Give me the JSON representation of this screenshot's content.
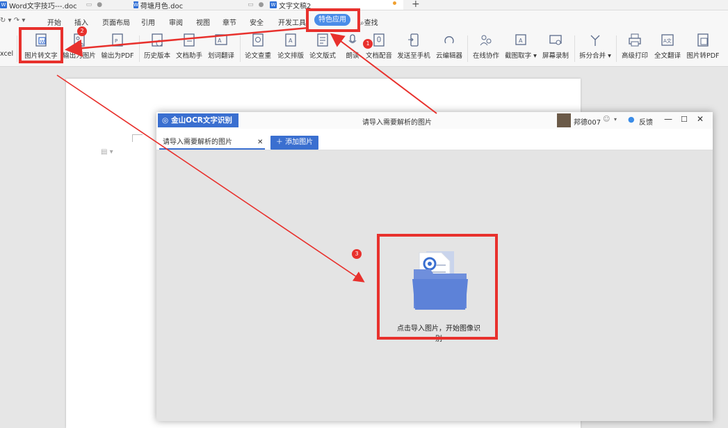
{
  "doc_tabs": [
    {
      "label": "Word文字技巧---.doc"
    },
    {
      "label": "荷塘月色.doc"
    },
    {
      "label": "文字文稿2"
    }
  ],
  "menu": {
    "items": [
      "开始",
      "插入",
      "页面布局",
      "引用",
      "审阅",
      "视图",
      "章节",
      "安全",
      "开发工具"
    ],
    "special": "特色应用",
    "search": "查找"
  },
  "ribbon": {
    "left_cut": "xcel",
    "tools": [
      {
        "label": "图片转文字",
        "icon": "image-to-text-icon"
      },
      {
        "label": "输出为图片",
        "icon": "export-image-icon"
      },
      {
        "label": "输出为PDF",
        "icon": "export-pdf-icon"
      },
      {
        "label": "历史版本",
        "icon": "history-icon"
      },
      {
        "label": "文档助手",
        "icon": "doc-assistant-icon"
      },
      {
        "label": "划词翻译",
        "icon": "translate-icon"
      },
      {
        "label": "论文查重",
        "icon": "paper-check-icon"
      },
      {
        "label": "论文排版",
        "icon": "paper-layout-icon"
      },
      {
        "label": "论文版式",
        "icon": "paper-format-icon"
      },
      {
        "label": "朗读",
        "icon": "read-aloud-icon"
      },
      {
        "label": "文档配音",
        "icon": "dubbing-icon"
      },
      {
        "label": "发送至手机",
        "icon": "send-phone-icon"
      },
      {
        "label": "云编辑器",
        "icon": "cloud-editor-icon"
      },
      {
        "label": "在线协作",
        "icon": "collaborate-icon"
      },
      {
        "label": "截图取字",
        "icon": "screenshot-text-icon"
      },
      {
        "label": "屏幕录制",
        "icon": "screen-record-icon"
      },
      {
        "label": "拆分合并",
        "icon": "split-merge-icon"
      },
      {
        "label": "高级打印",
        "icon": "print-icon"
      },
      {
        "label": "全文翻译",
        "icon": "full-translate-icon"
      },
      {
        "label": "图片转PDF",
        "icon": "image-to-pdf-icon"
      }
    ]
  },
  "dialog": {
    "app_name": "金山OCR文字识别",
    "title": "请导入需要解析的图片",
    "user": "邦德007",
    "feedback": "反馈",
    "tab_label": "请导入需要解析的图片",
    "add_button": "添加图片",
    "import_hint": "点击导入图片，开始图像识别"
  },
  "annotations": {
    "badge1": "1",
    "badge2": "2",
    "badge3": "3"
  },
  "colors": {
    "accent": "#3a6fd0",
    "highlight": "#e8312d",
    "pill": "#4a8ce8"
  }
}
